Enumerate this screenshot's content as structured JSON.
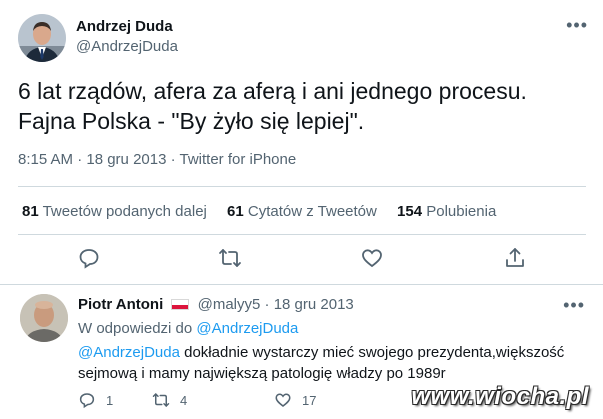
{
  "main_tweet": {
    "display_name": "Andrzej Duda",
    "handle": "@AndrzejDuda",
    "text": "6 lat rządów, afera za aferą i ani jednego procesu. Fajna Polska - \"By żyło się lepiej\".",
    "timestamp": "8:15 AM · 18 gru 2013 · Twitter for iPhone",
    "stats": [
      {
        "count": "81",
        "label": "Tweetów podanych dalej"
      },
      {
        "count": "61",
        "label": "Cytatów z Tweetów"
      },
      {
        "count": "154",
        "label": "Polubienia"
      }
    ],
    "actions": [
      "reply-icon",
      "retweet-icon",
      "like-icon",
      "share-icon"
    ]
  },
  "reply": {
    "display_name": "Piotr Antoni",
    "handle": "@malyy5",
    "date": "18 gru 2013",
    "separator": "·",
    "reply_to_prefix": "W odpowiedzi do",
    "reply_to_handle": "@AndrzejDuda",
    "mention": "@AndrzejDuda",
    "text": " dokładnie wystarczy mieć swojego prezydenta,większość sejmową i mamy największą patologię władzy po 1989r",
    "counts": {
      "replies": "1",
      "retweets": "4",
      "likes": "17"
    }
  },
  "watermark": "www.wiocha.pl",
  "colors": {
    "link": "#1d9bf0",
    "secondary_text": "#536471",
    "divider": "#cfd9de"
  }
}
